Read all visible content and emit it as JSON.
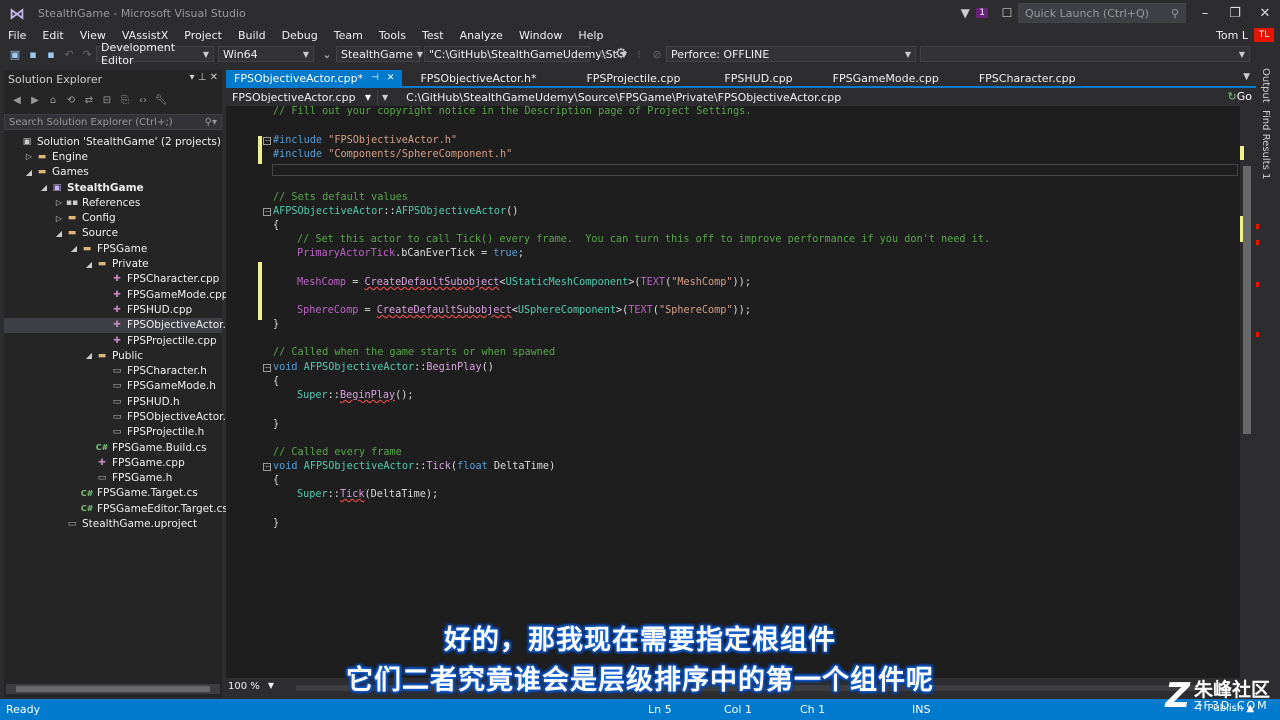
{
  "window": {
    "title": "StealthGame - Microsoft Visual Studio",
    "notification_count": "1",
    "quick_launch_placeholder": "Quick Launch (Ctrl+Q)"
  },
  "menu": {
    "items": [
      "File",
      "Edit",
      "View",
      "VAssistX",
      "Project",
      "Build",
      "Debug",
      "Team",
      "Tools",
      "Test",
      "Analyze",
      "Window",
      "Help"
    ],
    "user_name": "Tom L",
    "user_initials": "TL"
  },
  "toolbar": {
    "configuration": "Development Editor",
    "platform": "Win64",
    "startup_project": "StealthGame",
    "command_args": "\"C:\\GitHub\\StealthGameUdemy\\St",
    "perforce_status": "Perforce: OFFLINE"
  },
  "solution_explorer": {
    "title": "Solution Explorer",
    "search_placeholder": "Search Solution Explorer (Ctrl+;)",
    "tree": [
      {
        "label": "Solution 'StealthGame' (2 projects)",
        "depth": 0,
        "icon": "sln",
        "expander": ""
      },
      {
        "label": "Engine",
        "depth": 1,
        "icon": "folder",
        "expander": "▷"
      },
      {
        "label": "Games",
        "depth": 1,
        "icon": "folder",
        "expander": "◢"
      },
      {
        "label": "StealthGame",
        "depth": 2,
        "icon": "proj",
        "expander": "◢",
        "bold": true
      },
      {
        "label": "References",
        "depth": 3,
        "icon": "ref",
        "expander": "▷"
      },
      {
        "label": "Config",
        "depth": 3,
        "icon": "folder",
        "expander": "▷"
      },
      {
        "label": "Source",
        "depth": 3,
        "icon": "folder",
        "expander": "◢"
      },
      {
        "label": "FPSGame",
        "depth": 4,
        "icon": "folder",
        "expander": "◢"
      },
      {
        "label": "Private",
        "depth": 5,
        "icon": "folder",
        "expander": "◢"
      },
      {
        "label": "FPSCharacter.cpp",
        "depth": 6,
        "icon": "cpp",
        "expander": ""
      },
      {
        "label": "FPSGameMode.cpp",
        "depth": 6,
        "icon": "cpp",
        "expander": ""
      },
      {
        "label": "FPSHUD.cpp",
        "depth": 6,
        "icon": "cpp",
        "expander": ""
      },
      {
        "label": "FPSObjectiveActor.cpp",
        "depth": 6,
        "icon": "cpp",
        "expander": "",
        "selected": true
      },
      {
        "label": "FPSProjectile.cpp",
        "depth": 6,
        "icon": "cpp",
        "expander": ""
      },
      {
        "label": "Public",
        "depth": 5,
        "icon": "folder",
        "expander": "◢"
      },
      {
        "label": "FPSCharacter.h",
        "depth": 6,
        "icon": "h",
        "expander": ""
      },
      {
        "label": "FPSGameMode.h",
        "depth": 6,
        "icon": "h",
        "expander": ""
      },
      {
        "label": "FPSHUD.h",
        "depth": 6,
        "icon": "h",
        "expander": ""
      },
      {
        "label": "FPSObjectiveActor.h",
        "depth": 6,
        "icon": "h",
        "expander": ""
      },
      {
        "label": "FPSProjectile.h",
        "depth": 6,
        "icon": "h",
        "expander": ""
      },
      {
        "label": "FPSGame.Build.cs",
        "depth": 5,
        "icon": "cs",
        "expander": ""
      },
      {
        "label": "FPSGame.cpp",
        "depth": 5,
        "icon": "cpp",
        "expander": ""
      },
      {
        "label": "FPSGame.h",
        "depth": 5,
        "icon": "h",
        "expander": ""
      },
      {
        "label": "FPSGame.Target.cs",
        "depth": 4,
        "icon": "cs",
        "expander": ""
      },
      {
        "label": "FPSGameEditor.Target.cs",
        "depth": 4,
        "icon": "cs",
        "expander": ""
      },
      {
        "label": "StealthGame.uproject",
        "depth": 3,
        "icon": "h",
        "expander": ""
      }
    ]
  },
  "tabs": [
    {
      "label": "FPSObjectiveActor.cpp*",
      "active": true
    },
    {
      "label": "FPSObjectiveActor.h*"
    },
    {
      "label": "FPSProjectile.cpp"
    },
    {
      "label": "FPSHUD.cpp"
    },
    {
      "label": "FPSGameMode.cpp"
    },
    {
      "label": "FPSCharacter.cpp"
    }
  ],
  "nav": {
    "file": "FPSObjectiveActor.cpp",
    "path": "C:\\GitHub\\StealthGameUdemy\\Source\\FPSGame\\Private\\FPSObjectiveActor.cpp",
    "go_label": "Go"
  },
  "code": {
    "l01": "// Fill out your copyright notice in the Description page of Project Settings.",
    "l02a": "#include ",
    "l02b": "\"FPSObjectiveActor.h\"",
    "l03a": "#include ",
    "l03b": "\"Components/SphereComponent.h\"",
    "l04": "// Sets default values",
    "l05a": "AFPSObjectiveActor",
    "l05b": "::",
    "l05c": "AFPSObjectiveActor",
    "l05d": "()",
    "l06": "{",
    "l07": "// Set this actor to call Tick() every frame.  You can turn this off to improve performance if you don't need it.",
    "l08a": "PrimaryActorTick",
    "l08b": ".bCanEverTick = ",
    "l08c": "true",
    "l08d": ";",
    "l09a": "MeshComp",
    "l09b": " = ",
    "l09c": "CreateDefaultSubobject",
    "l09d": "<",
    "l09e": "UStaticMeshComponent",
    "l09f": ">(",
    "l09g": "TEXT",
    "l09h": "(",
    "l09i": "\"MeshComp\"",
    "l09j": "));",
    "l10a": "SphereComp",
    "l10b": " = ",
    "l10c": "CreateDefaultSubobject",
    "l10d": "<",
    "l10e": "USphereComponent",
    "l10f": ">(",
    "l10g": "TEXT",
    "l10h": "(",
    "l10i": "\"SphereComp\"",
    "l10j": "));",
    "l11": "}",
    "l12": "// Called when the game starts or when spawned",
    "l13a": "void",
    "l13b": " AFPSObjectiveActor",
    "l13c": "::",
    "l13d": "BeginPlay",
    "l13e": "()",
    "l14": "{",
    "l15a": "Super",
    "l15b": "::",
    "l15c": "BeginPlay",
    "l15d": "();",
    "l16": "}",
    "l17": "// Called every frame",
    "l18a": "void",
    "l18b": " AFPSObjectiveActor",
    "l18c": "::",
    "l18d": "Tick",
    "l18e": "(",
    "l18f": "float",
    "l18g": " DeltaTime)",
    "l19": "{",
    "l20a": "Super",
    "l20b": "::",
    "l20c": "Tick",
    "l20d": "(DeltaTime);",
    "l21": "}"
  },
  "zoom": "100 %",
  "side_tabs": [
    "Output",
    "Find Results 1"
  ],
  "status": {
    "ready": "Ready",
    "ln": "Ln 5",
    "col": "Col 1",
    "ch": "Ch 1",
    "mode": "INS",
    "publish": "↑ Publish ▲"
  },
  "subtitles": {
    "line1": "好的，那我现在需要指定根组件",
    "line2": "它们二者究竟谁会是层级排序中的第一个组件呢"
  },
  "watermark": {
    "cn": "朱峰社区",
    "en": "ZF3D.COM"
  },
  "colors": {
    "accent": "#007acc",
    "background": "#2d2d30",
    "editor_bg": "#1e1e1e"
  }
}
